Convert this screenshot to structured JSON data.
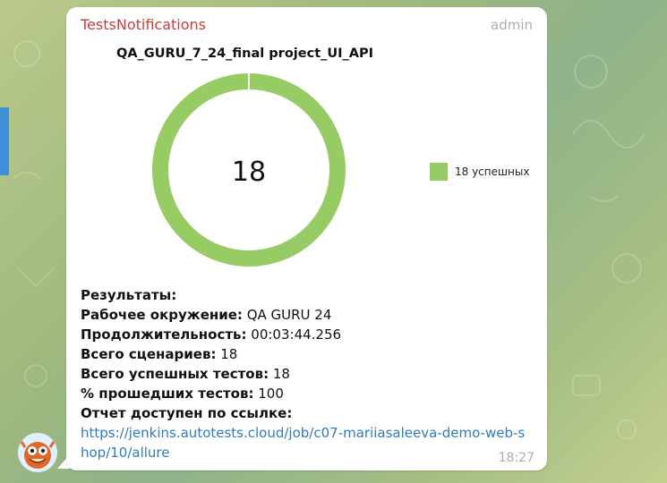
{
  "message": {
    "sender": "TestsNotifications",
    "role": "admin",
    "time": "18:27"
  },
  "chart_data": {
    "type": "pie",
    "title": "QA_GURU_7_24_final project_UI_API",
    "center_label": "18",
    "series": [
      {
        "name": "18 успешных",
        "values": [
          18
        ]
      }
    ],
    "colors": [
      "#97cc64"
    ]
  },
  "results": {
    "heading": "Результаты:",
    "rows": [
      {
        "label": "Рабочее окружение:",
        "value": " QA GURU 24"
      },
      {
        "label": "Продолжительность:",
        "value": " 00:03:44.256"
      },
      {
        "label": "Всего сценариев:",
        "value": " 18"
      },
      {
        "label": "Всего успешных тестов:",
        "value": " 18"
      },
      {
        "label": "% прошедших тестов:",
        "value": " 100"
      }
    ],
    "link_label": "Отчет доступен по ссылке:",
    "link": "https://jenkins.autotests.cloud/job/c07-mariiasaleeva-demo-web-shop/10/allure"
  }
}
